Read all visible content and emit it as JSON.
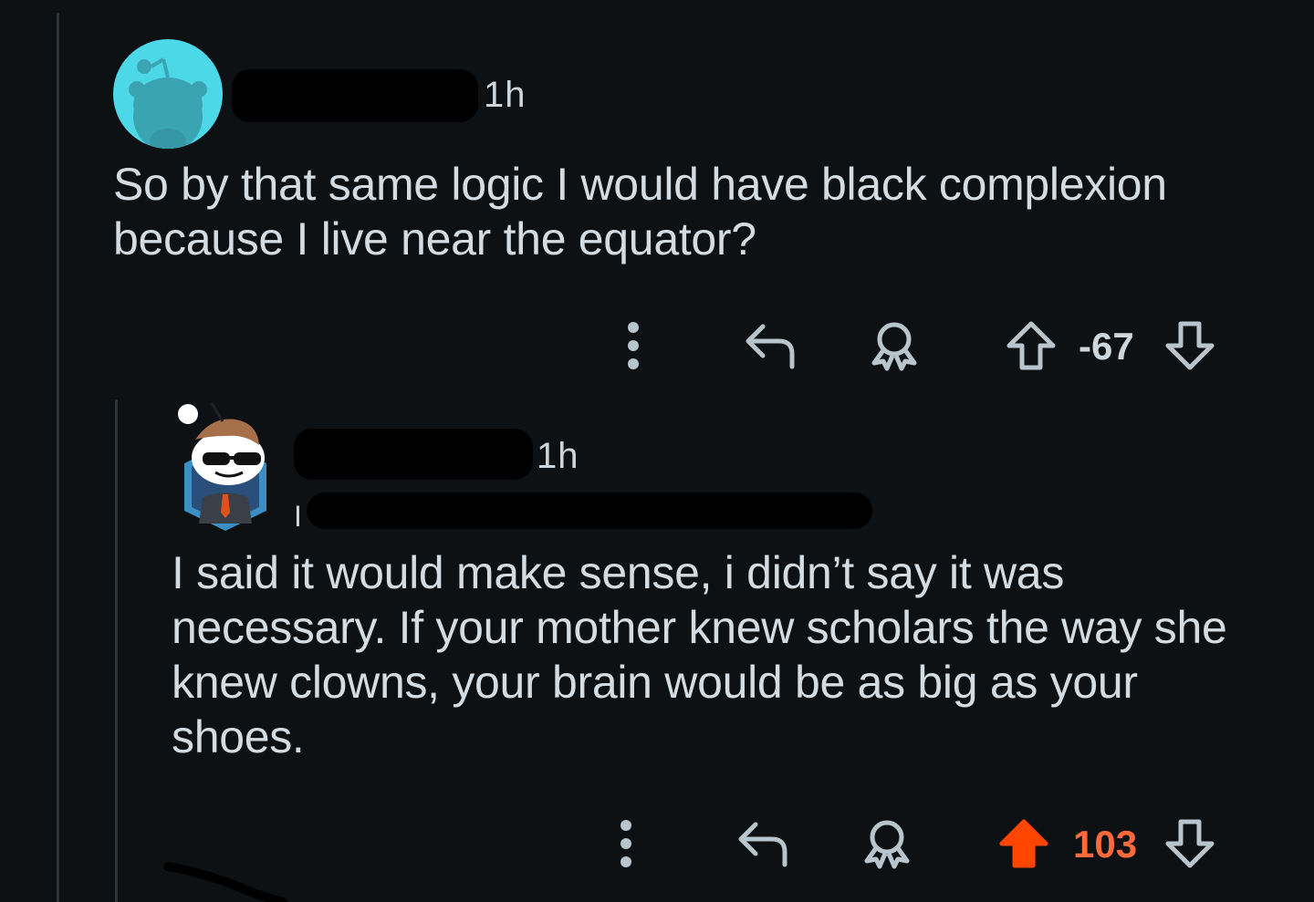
{
  "comments": [
    {
      "time": "1h",
      "text": "So by that same logic I would have black complexion because I live near the equator?",
      "score": "-67",
      "avatar": "snoo-avatar-default",
      "vote_state": "none"
    },
    {
      "time": "1h",
      "flair_prefix": "I",
      "text": "I said it would make sense, i didn’t say it was necessary. If your mother knew scholars the way she knew clowns, your brain would be as big as your shoes.",
      "score": "103",
      "avatar": "snoo-avatar-sunglasses-suit",
      "vote_state": "upvoted"
    }
  ],
  "colors": {
    "background": "#0e1113",
    "text": "#d3dce2",
    "icon": "#b8c5cc",
    "upvote_active": "#ff4500",
    "score_active": "#ff6a3d",
    "avatar_bg": "#4dd8e8"
  },
  "icons": [
    "more-icon",
    "reply-icon",
    "award-icon",
    "upvote-icon",
    "downvote-icon"
  ]
}
